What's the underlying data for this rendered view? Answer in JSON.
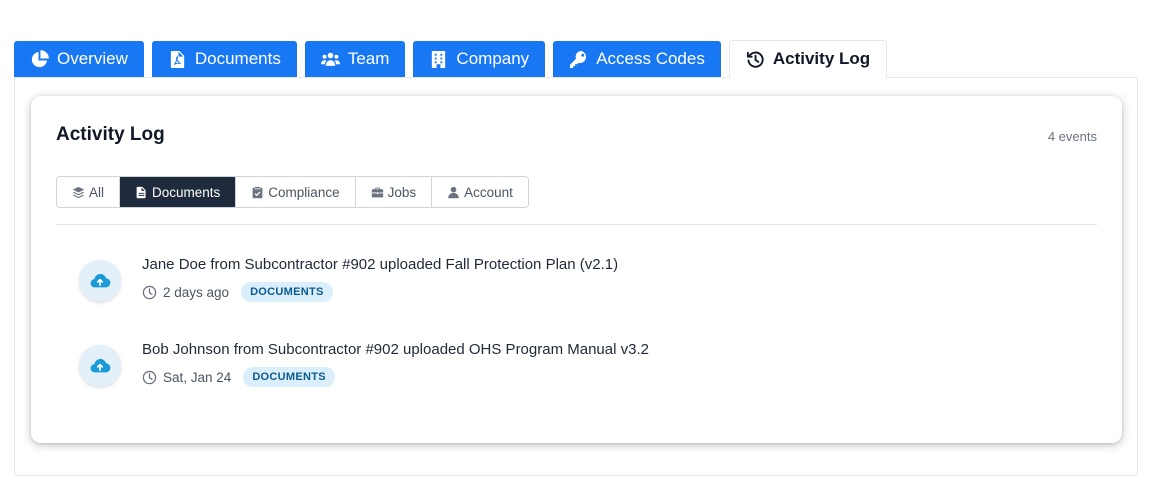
{
  "tabs": [
    {
      "label": "Overview",
      "icon": "pie-chart-icon"
    },
    {
      "label": "Documents",
      "icon": "pdf-file-icon"
    },
    {
      "label": "Team",
      "icon": "users-icon"
    },
    {
      "label": "Company",
      "icon": "building-icon"
    },
    {
      "label": "Access Codes",
      "icon": "key-icon"
    },
    {
      "label": "Activity Log",
      "icon": "history-icon",
      "active": true
    }
  ],
  "activity": {
    "title": "Activity Log",
    "count": "4 events",
    "filters": [
      {
        "label": "All",
        "icon": "layers-icon"
      },
      {
        "label": "Documents",
        "icon": "file-icon",
        "selected": true
      },
      {
        "label": "Compliance",
        "icon": "clipboard-check-icon"
      },
      {
        "label": "Jobs",
        "icon": "briefcase-icon"
      },
      {
        "label": "Account",
        "icon": "user-icon"
      }
    ],
    "events": [
      {
        "text": "Jane Doe from Subcontractor #902 uploaded Fall Protection Plan (v2.1)",
        "time": "2 days ago",
        "badge": "DOCUMENTS",
        "icon": "cloud-upload-icon"
      },
      {
        "text": "Bob Johnson from Subcontractor #902 uploaded OHS Program Manual v3.2",
        "time": "Sat, Jan 24",
        "badge": "DOCUMENTS",
        "icon": "cloud-upload-icon"
      }
    ]
  },
  "colors": {
    "tab_blue": "#1877f2",
    "filter_selected": "#1f2a3c",
    "badge_bg": "#dbeefb",
    "badge_text": "#0b5a8e",
    "upload_icon": "#1a9bd7"
  }
}
